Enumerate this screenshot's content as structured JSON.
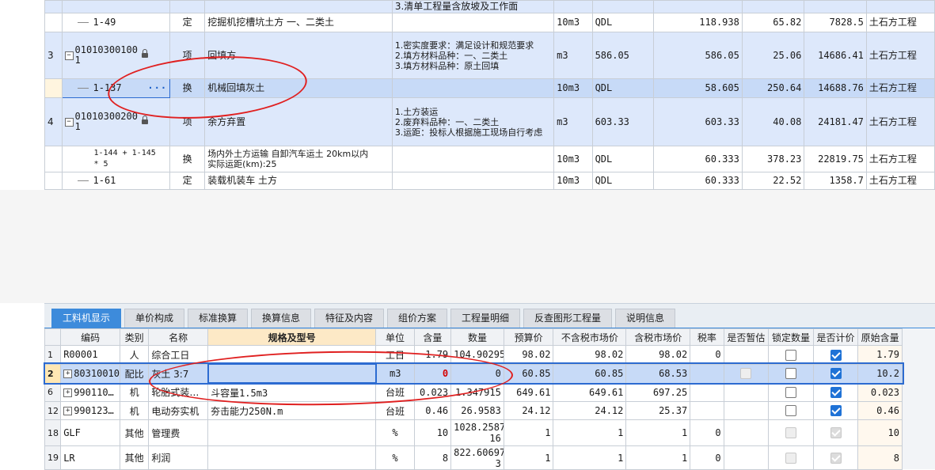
{
  "upper_grid": {
    "rows": [
      {
        "idx": "",
        "code": "",
        "type": "",
        "name": "",
        "features": "3.清单工程量含放坡及工作面",
        "unit": "",
        "expr": "",
        "qty": "",
        "price": "",
        "total": "",
        "category": ""
      },
      {
        "idx": "",
        "code": "1-49",
        "type": "定",
        "name": "挖掘机挖槽坑土方 一、二类土",
        "features": "",
        "unit": "10m3",
        "expr": "QDL",
        "qty": "118.938",
        "price": "65.82",
        "total": "7828.5",
        "category": "土石方工程"
      },
      {
        "idx": "3",
        "code": "01010300100\n1",
        "type": "项",
        "name": "回填方",
        "features": "1.密实度要求：满足设计和规范要求\n2.填方材料品种：一、二类土\n3.填方材料品种：原土回填",
        "unit": "m3",
        "expr": "586.05",
        "qty": "586.05",
        "price": "25.06",
        "total": "14686.41",
        "category": "土石方工程"
      },
      {
        "idx": "",
        "code": "1-137",
        "type": "换",
        "name": "机械回填灰土",
        "features": "",
        "unit": "10m3",
        "expr": "QDL",
        "qty": "58.605",
        "price": "250.64",
        "total": "14688.76",
        "category": "土石方工程"
      },
      {
        "idx": "4",
        "code": "01010300200\n1",
        "type": "项",
        "name": "余方弃置",
        "features": "1.土方装运\n2.废弃料品种：一、二类土\n3.运距：投标人根据施工现场自行考虑",
        "unit": "m3",
        "expr": "603.33",
        "qty": "603.33",
        "price": "40.08",
        "total": "24181.47",
        "category": "土石方工程"
      },
      {
        "idx": "",
        "code": "1-144 + 1-145\n* 5",
        "type": "换",
        "name": "场内外土方运输 自卸汽车运土 20km以内\n 实际运距(km):25",
        "features": "",
        "unit": "10m3",
        "expr": "QDL",
        "qty": "60.333",
        "price": "378.23",
        "total": "22819.75",
        "category": "土石方工程"
      },
      {
        "idx": "",
        "code": "1-61",
        "type": "定",
        "name": "装载机装车 土方",
        "features": "",
        "unit": "10m3",
        "expr": "QDL",
        "qty": "60.333",
        "price": "22.52",
        "total": "1358.7",
        "category": "土石方工程"
      }
    ]
  },
  "tabs": [
    "工料机显示",
    "单价构成",
    "标准换算",
    "换算信息",
    "特征及内容",
    "组价方案",
    "工程量明细",
    "反查图形工程量",
    "说明信息"
  ],
  "lower_grid": {
    "headers": [
      "编码",
      "类别",
      "名称",
      "规格及型号",
      "单位",
      "含量",
      "数量",
      "预算价",
      "不含税市场价",
      "含税市场价",
      "税率",
      "是否暂估",
      "锁定数量",
      "是否计价",
      "原始含量"
    ],
    "rows": [
      {
        "idx": "1",
        "expand": false,
        "code": "R00001",
        "type": "人",
        "name": "综合工日",
        "spec": "",
        "unit": "工日",
        "content": "1.79",
        "qty": "104.90295",
        "budget": "98.02",
        "mkt_notax": "98.02",
        "mkt_tax": "98.02",
        "tax": "0",
        "est": "",
        "lock": "off",
        "price_flag": "on",
        "orig": "1.79"
      },
      {
        "idx": "2",
        "expand": true,
        "code": "80310010",
        "type": "配比",
        "name": "灰土 3:7",
        "spec": "",
        "unit": "m3",
        "content": "0",
        "qty": "0",
        "budget": "60.85",
        "mkt_notax": "60.85",
        "mkt_tax": "68.53",
        "tax": "",
        "est": "dis",
        "lock": "off",
        "price_flag": "on",
        "orig": "10.2"
      },
      {
        "idx": "6",
        "expand": true,
        "code": "990110…",
        "type": "机",
        "name": "轮胎式装…",
        "spec": "斗容量1.5m3",
        "unit": "台班",
        "content": "0.023",
        "qty": "1.347915",
        "budget": "649.61",
        "mkt_notax": "649.61",
        "mkt_tax": "697.25",
        "tax": "",
        "est": "",
        "lock": "off",
        "price_flag": "on",
        "orig": "0.023"
      },
      {
        "idx": "12",
        "expand": true,
        "code": "990123…",
        "type": "机",
        "name": "电动夯实机",
        "spec": "夯击能力250N.m",
        "unit": "台班",
        "content": "0.46",
        "qty": "26.9583",
        "budget": "24.12",
        "mkt_notax": "24.12",
        "mkt_tax": "25.37",
        "tax": "",
        "est": "",
        "lock": "off",
        "price_flag": "on",
        "orig": "0.46"
      },
      {
        "idx": "18",
        "expand": false,
        "code": "GLF",
        "type": "其他",
        "name": "管理费",
        "spec": "",
        "unit": "%",
        "content": "10",
        "qty": "1028.2587\n16",
        "budget": "1",
        "mkt_notax": "1",
        "mkt_tax": "1",
        "tax": "0",
        "est": "",
        "lock": "dis",
        "price_flag": "dison",
        "orig": "10"
      },
      {
        "idx": "19",
        "expand": false,
        "code": "LR",
        "type": "其他",
        "name": "利润",
        "spec": "",
        "unit": "%",
        "content": "8",
        "qty": "822.60697\n3",
        "budget": "1",
        "mkt_notax": "1",
        "mkt_tax": "1",
        "tax": "0",
        "est": "",
        "lock": "dis",
        "price_flag": "dison",
        "orig": "8"
      }
    ]
  },
  "colors": {
    "accent": "#3d8bdb",
    "band": "#dde8fb",
    "selected": "#c7daf7",
    "annotation": "#e02020"
  },
  "icons": [
    "lock-icon",
    "expand-icon",
    "checkbox-icon",
    "ellipsis-icon"
  ]
}
